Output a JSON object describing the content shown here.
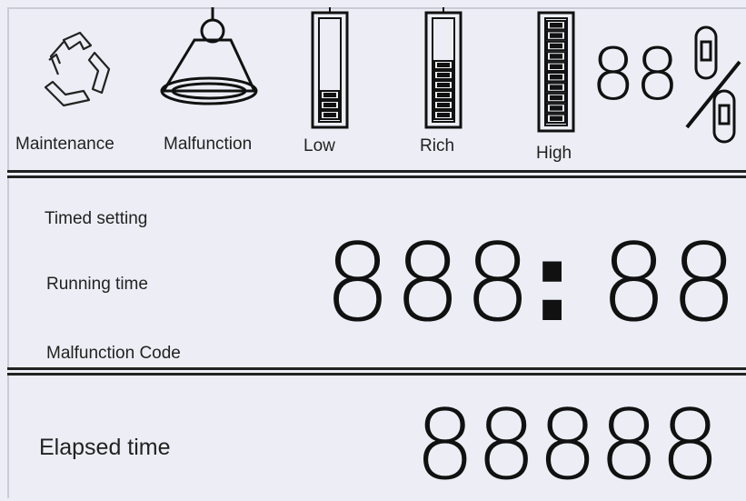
{
  "indicators": {
    "maintenance_label": "Maintenance",
    "malfunction_label": "Malfunction",
    "low_label": "Low",
    "rich_label": "Rich",
    "high_label": "High",
    "percent_value": "88",
    "low_level": 0.25,
    "rich_level": 0.55,
    "high_level": 1.0
  },
  "timer": {
    "timed_setting_label": "Timed setting",
    "running_time_label": "Running time",
    "malfunction_code_label": "Malfunction Code",
    "hours": "888",
    "separator": ":",
    "minutes": "88"
  },
  "elapsed": {
    "label": "Elapsed time",
    "value": "88888"
  }
}
